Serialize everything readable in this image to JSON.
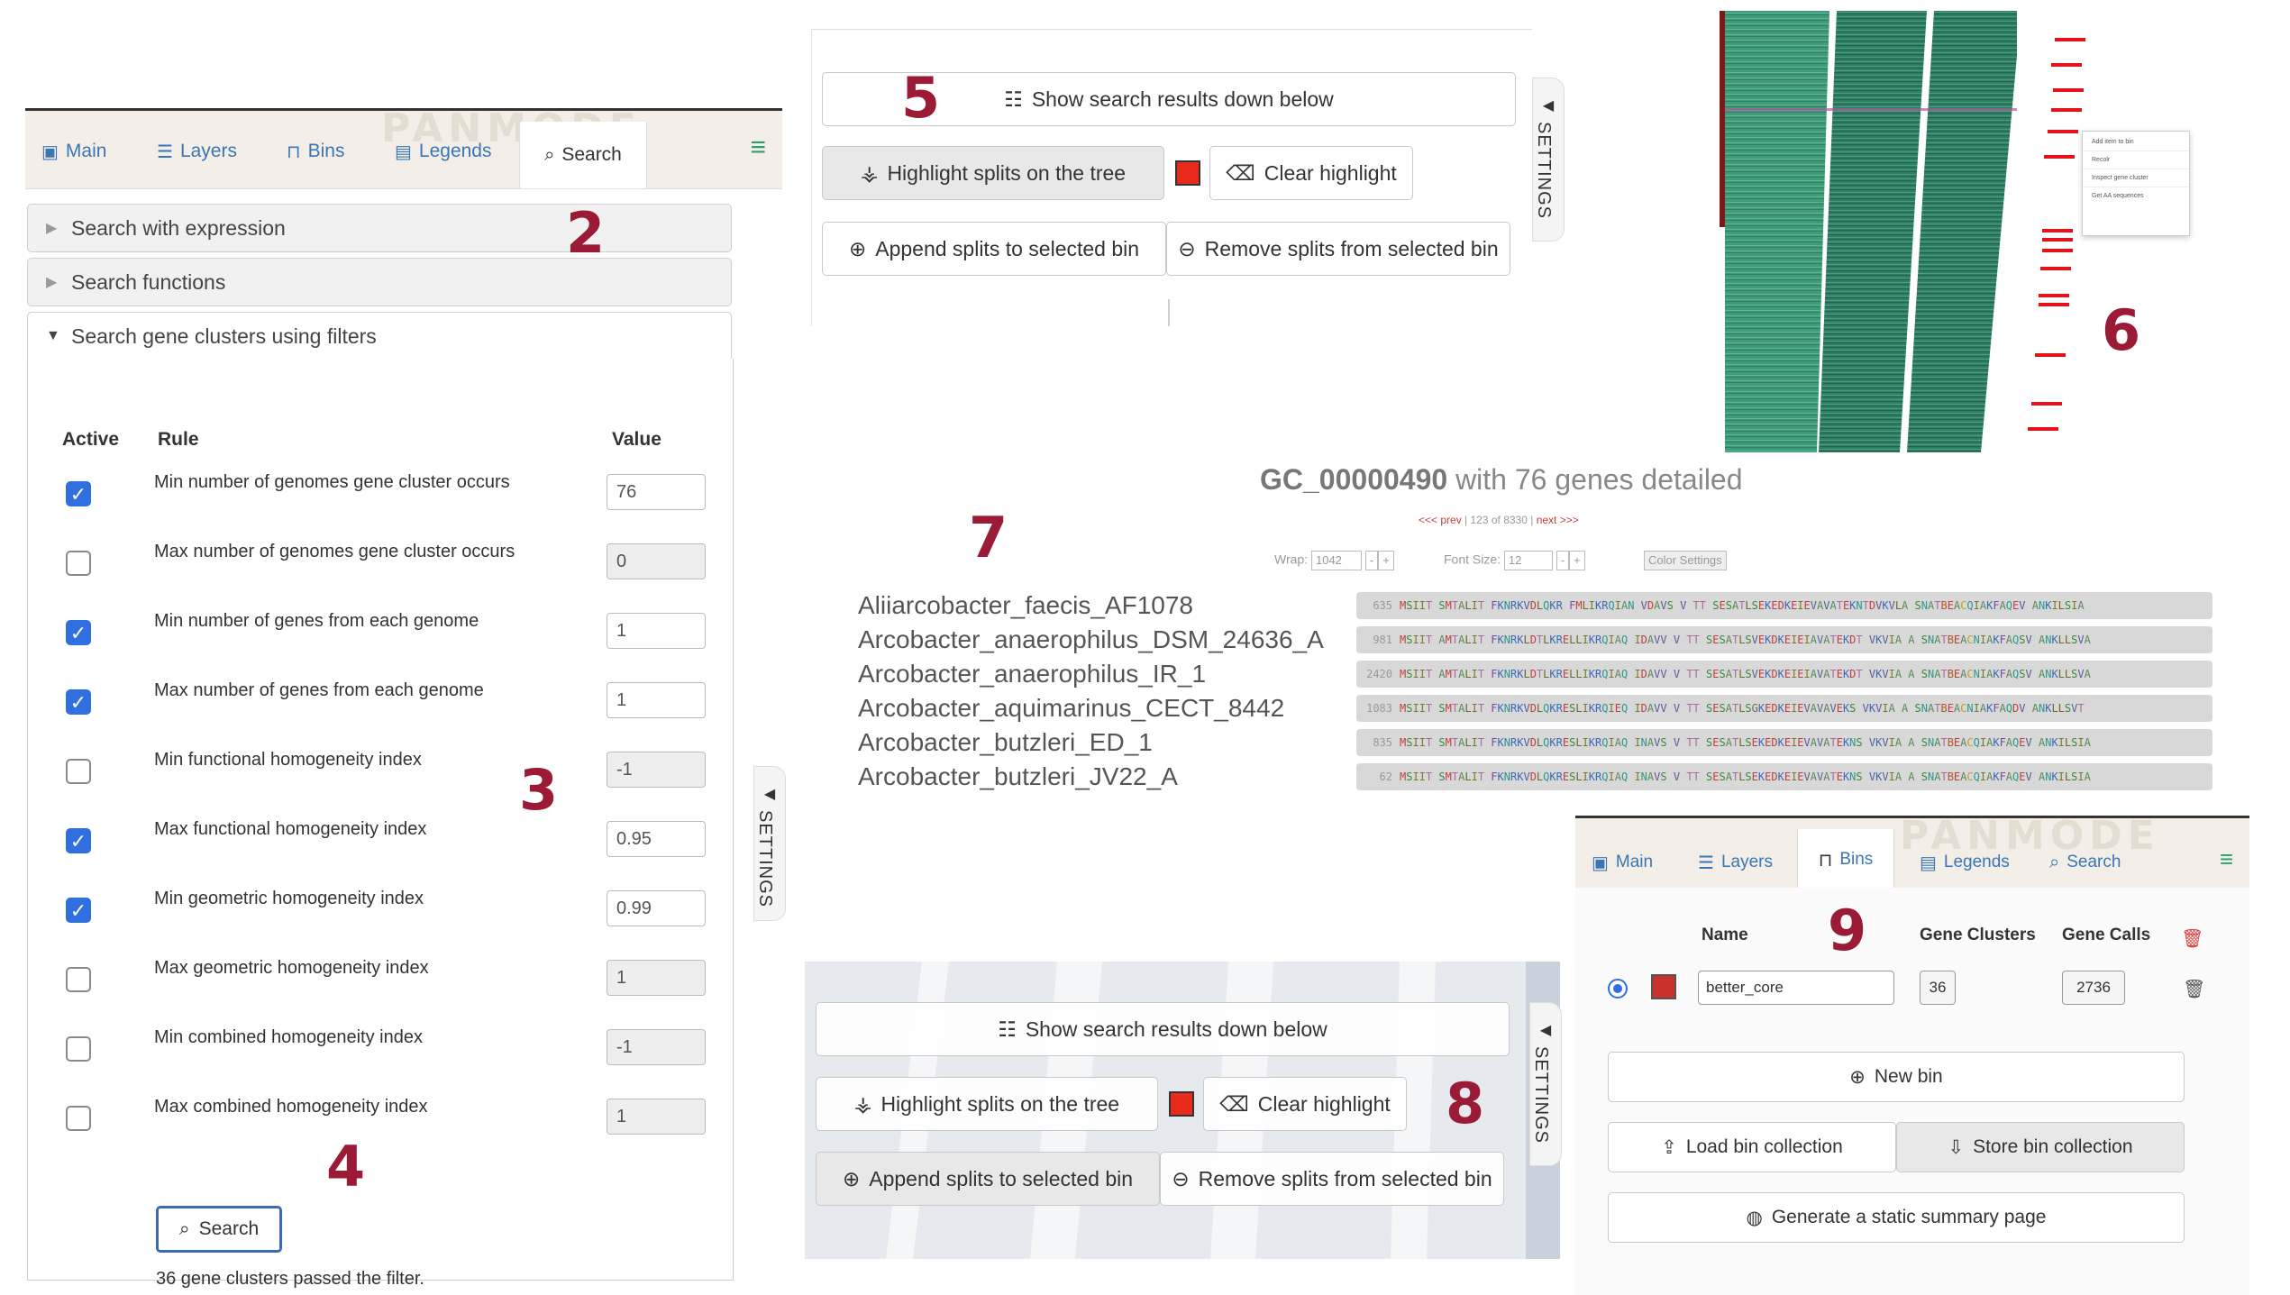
{
  "markers": [
    "2",
    "3",
    "4",
    "5",
    "6",
    "7",
    "8",
    "9"
  ],
  "tabs": {
    "brand": "PANMODE",
    "main": "Main",
    "layers": "Layers",
    "bins": "Bins",
    "legends": "Legends",
    "search": "Search"
  },
  "search_panel": {
    "accordion_expression": "Search with expression",
    "accordion_functions": "Search functions",
    "accordion_filters": "Search gene clusters using filters",
    "col_active": "Active",
    "col_rule": "Rule",
    "col_value": "Value",
    "filters": [
      {
        "rule": "Min number of genomes gene cluster occurs",
        "value": "76",
        "checked": true
      },
      {
        "rule": "Max number of genomes gene cluster occurs",
        "value": "0",
        "checked": false
      },
      {
        "rule": "Min number of genes from each genome",
        "value": "1",
        "checked": true
      },
      {
        "rule": "Max number of genes from each genome",
        "value": "1",
        "checked": true
      },
      {
        "rule": "Min functional homogeneity index",
        "value": "-1",
        "checked": false
      },
      {
        "rule": "Max functional homogeneity index",
        "value": "0.95",
        "checked": true
      },
      {
        "rule": "Min geometric homogeneity index",
        "value": "0.99",
        "checked": true
      },
      {
        "rule": "Max geometric homogeneity index",
        "value": "1",
        "checked": false
      },
      {
        "rule": "Min combined homogeneity index",
        "value": "-1",
        "checked": false
      },
      {
        "rule": "Max combined homogeneity index",
        "value": "1",
        "checked": false
      }
    ],
    "search_button": "Search",
    "result_text": "36 gene clusters passed the filter.",
    "settings_label": "SETTINGS"
  },
  "actions": {
    "show_results": "Show search results down below",
    "highlight": "Highlight splits on the tree",
    "clear_highlight": "Clear highlight",
    "append": "Append splits to selected bin",
    "remove": "Remove splits from selected bin",
    "highlight_color": "#e82b1b",
    "settings_label": "SETTINGS"
  },
  "context_menu": {
    "items": [
      "Add item to bin",
      "Recolr",
      "Inspect gene cluster",
      "Get AA sequences"
    ]
  },
  "gene_detail": {
    "cluster_id": "GC_00000490",
    "title_rest": "with 76 genes detailed",
    "nav_prev": "<<< prev",
    "nav_pos": "123 of 8330",
    "nav_next": "next >>>",
    "wrap_label": "Wrap:",
    "wrap_value": "1042",
    "font_label": "Font Size:",
    "font_value": "12",
    "color_settings": "Color Settings",
    "genomes": [
      {
        "name": "Aliiarcobacter_faecis_AF1078",
        "num": "635",
        "seq": "MSIIT SMTALIT FKNRKVDLQKR FMLIKRQIAN VDAVS V TT SESATLSEKEDKEIEVAVATEKNTDVKVLA SNATBEACQIAKFAQEV ANKILSIA"
      },
      {
        "name": "Arcobacter_anaerophilus_DSM_24636_A",
        "num": "981",
        "seq": "MSIIT AMTALIT FKNRKLDTLKRELLIKRQIAQ IDAVV V TT SESATLSVEKDKEIEIAVATEKDT VKVIA A SNATBEACNIAKFAQSV ANKLLSVA"
      },
      {
        "name": "Arcobacter_anaerophilus_IR_1",
        "num": "2420",
        "seq": "MSIIT AMTALIT FKNRKLDTLKRELLIKRQIAQ IDAVV V TT SESATLSVEKDKEIEIAVATEKDT VKVIA A SNATBEACNIAKFAQSV ANKLLSVA"
      },
      {
        "name": "Arcobacter_aquimarinus_CECT_8442",
        "num": "1083",
        "seq": "MSIIT SMTALIT FKNRKVDLQKRESLIKRQIEQ IDAVV V TT SESATLSGKEDKEIEVAVAVEKS VKVIA A SNATBEACNIAKFAQDV ANKLLSVT"
      },
      {
        "name": "Arcobacter_butzleri_ED_1",
        "num": "835",
        "seq": "MSIIT SMTALIT FKNRKVDLQKRESLIKRQIAQ INAVS V TT SESATLSEKEDKEIEVAVATEKNS VKVIA A SNATBEACQIAKFAQEV ANKILSIA"
      },
      {
        "name": "Arcobacter_butzleri_JV22_A",
        "num": "62",
        "seq": "MSIIT SMTALIT FKNRKVDLQKRESLIKRQIAQ INAVS V TT SESATLSEKEDKEIEVAVATEKNS VKVIA A SNATBEACQIAKFAQEV ANKILSIA"
      }
    ]
  },
  "bins_panel": {
    "col_name": "Name",
    "col_gene_clusters": "Gene Clusters",
    "col_gene_calls": "Gene Calls",
    "bin_name": "better_core",
    "bin_color": "#c8322b",
    "bin_gene_clusters": "36",
    "bin_gene_calls": "2736",
    "new_bin": "New bin",
    "load_collection": "Load bin collection",
    "store_collection": "Store bin collection",
    "static_summary": "Generate a static summary page"
  }
}
